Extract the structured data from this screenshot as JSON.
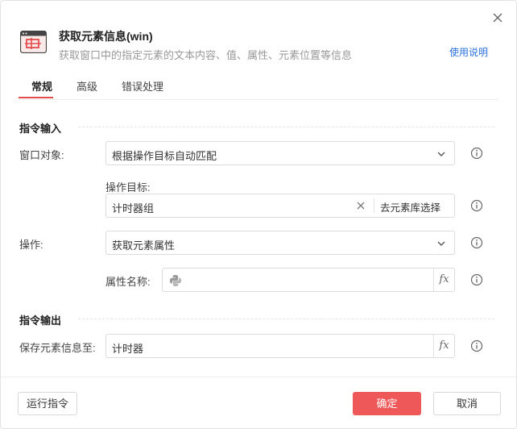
{
  "header": {
    "title": "获取元素信息(win)",
    "subtitle": "获取窗口中的指定元素的文本内容、值、属性、元素位置等信息",
    "help_link": "使用说明"
  },
  "tabs": [
    {
      "label": "常规",
      "active": true
    },
    {
      "label": "高级",
      "active": false
    },
    {
      "label": "错误处理",
      "active": false
    }
  ],
  "input_section": {
    "title": "指令输入",
    "window_object": {
      "label": "窗口对象:",
      "value": "根据操作目标自动匹配"
    },
    "target": {
      "label": "操作目标:",
      "value": "计时器组",
      "library_button": "去元素库选择"
    },
    "operation": {
      "label": "操作:",
      "value": "获取元素属性"
    },
    "attribute_name": {
      "label": "属性名称:",
      "value": ""
    }
  },
  "output_section": {
    "title": "指令输出",
    "save_to": {
      "label": "保存元素信息至:",
      "value": "计时器"
    }
  },
  "footer": {
    "run_label": "运行指令",
    "confirm_label": "确定",
    "cancel_label": "取消"
  },
  "icons": {
    "close": "close-icon",
    "header": "element-window-icon",
    "chevron": "chevron-down-icon",
    "info": "info-icon",
    "python": "python-icon",
    "fx": "fx"
  },
  "colors": {
    "accent": "#e24c4c",
    "primary_button": "#ee5858",
    "link": "#2a6fdb"
  }
}
